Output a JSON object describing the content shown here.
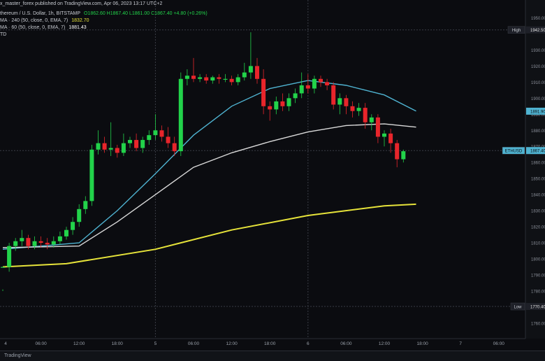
{
  "header": {
    "publisher": "x_master_forex published on TradingView.com, Apr 06, 2023 13:17 UTC+2",
    "symbol": "thereum / U.S. Dollar, 1h, BITSTAMP",
    "ohlc": "O1862.60  H1867.40  L1861.00  C1867.40  +4.80 (+0.26%)",
    "ma240_label": "MA · 240 (50, close, 0, EMA, 7)",
    "ma240_value": "1832.70",
    "ma60_label": "MA · 60 (50, close, 0, EMA, 7)",
    "ma60_value": "1881.43",
    "extra": "TD"
  },
  "footer": {
    "brand": "TradingView"
  },
  "colors": {
    "up": "#22d34a",
    "down": "#e8252b",
    "ema_fast": "#4fb3d1",
    "ema_mid": "#d9d9d9",
    "ema_slow": "#e6e33a",
    "bg": "#0b0c10"
  },
  "chart_data": {
    "type": "candlestick",
    "ylim": [
      1753,
      1955
    ],
    "y_ticks": [
      "1950.00",
      "1942.50",
      "1930.00",
      "1920.00",
      "1910.00",
      "1900.00",
      "1890.00",
      "1880.00",
      "1870.00",
      "1860.00",
      "1850.00",
      "1840.00",
      "1830.00",
      "1820.00",
      "1810.00",
      "1800.00",
      "1790.00",
      "1780.00",
      "1770.00",
      "1760.00"
    ],
    "x_ticks": [
      {
        "label": "4",
        "i": 0
      },
      {
        "label": "06:00",
        "i": 6
      },
      {
        "label": "12:00",
        "i": 12
      },
      {
        "label": "18:00",
        "i": 18
      },
      {
        "label": "5",
        "i": 24
      },
      {
        "label": "06:00",
        "i": 30
      },
      {
        "label": "12:00",
        "i": 36
      },
      {
        "label": "18:00",
        "i": 42
      },
      {
        "label": "6",
        "i": 48
      },
      {
        "label": "06:00",
        "i": 54
      },
      {
        "label": "12:00",
        "i": 60
      },
      {
        "label": "18:00",
        "i": 66
      },
      {
        "label": "7",
        "i": 72
      },
      {
        "label": "06:00",
        "i": 78
      }
    ],
    "day_separators": [
      24,
      48
    ],
    "price_labels": [
      {
        "text": "High",
        "value": "1942.50",
        "price": 1942.5,
        "style": "dark"
      },
      {
        "text": "",
        "value": "1891.90",
        "price": 1891.9,
        "style": "fast"
      },
      {
        "text": "ETHUSD",
        "value": "1867.40",
        "price": 1867.4,
        "style": "fast"
      },
      {
        "text": "Low",
        "value": "1770.40",
        "price": 1770.4,
        "style": "dark"
      }
    ],
    "candles": [
      [
        1795,
        1795,
        1781,
        1780
      ],
      [
        1795,
        1808,
        1810,
        1792
      ],
      [
        1808,
        1811,
        1813,
        1805
      ],
      [
        1811,
        1813,
        1818,
        1808
      ],
      [
        1813,
        1808,
        1815,
        1806
      ],
      [
        1808,
        1811,
        1814,
        1806
      ],
      [
        1811,
        1810,
        1814,
        1807
      ],
      [
        1810,
        1809,
        1813,
        1806
      ],
      [
        1809,
        1811,
        1814,
        1807
      ],
      [
        1811,
        1814,
        1817,
        1809
      ],
      [
        1814,
        1818,
        1820,
        1812
      ],
      [
        1818,
        1823,
        1826,
        1815
      ],
      [
        1823,
        1831,
        1834,
        1820
      ],
      [
        1831,
        1836,
        1839,
        1828
      ],
      [
        1836,
        1868,
        1871,
        1833
      ],
      [
        1868,
        1872,
        1880,
        1865
      ],
      [
        1872,
        1868,
        1876,
        1866
      ],
      [
        1868,
        1869,
        1885,
        1864
      ],
      [
        1869,
        1866,
        1871,
        1863
      ],
      [
        1866,
        1872,
        1878,
        1864
      ],
      [
        1872,
        1874,
        1876,
        1869
      ],
      [
        1874,
        1869,
        1878,
        1867
      ],
      [
        1869,
        1874,
        1876,
        1866
      ],
      [
        1874,
        1877,
        1880,
        1871
      ],
      [
        1877,
        1880,
        1890,
        1874
      ],
      [
        1880,
        1876,
        1883,
        1873
      ],
      [
        1876,
        1872,
        1882,
        1869
      ],
      [
        1872,
        1867,
        1876,
        1864
      ],
      [
        1867,
        1912,
        1916,
        1864
      ],
      [
        1912,
        1914,
        1918,
        1908
      ],
      [
        1914,
        1912,
        1925,
        1910
      ],
      [
        1912,
        1913,
        1915,
        1910
      ],
      [
        1913,
        1911,
        1915,
        1909
      ],
      [
        1911,
        1913,
        1914,
        1909
      ],
      [
        1913,
        1912,
        1915,
        1909
      ],
      [
        1912,
        1912,
        1915,
        1910
      ],
      [
        1912,
        1910,
        1914,
        1908
      ],
      [
        1910,
        1913,
        1915,
        1908
      ],
      [
        1913,
        1916,
        1922,
        1911
      ],
      [
        1916,
        1920,
        1941,
        1912
      ],
      [
        1920,
        1912,
        1925,
        1909
      ],
      [
        1912,
        1895,
        1918,
        1890
      ],
      [
        1895,
        1893,
        1898,
        1886
      ],
      [
        1893,
        1898,
        1901,
        1890
      ],
      [
        1898,
        1895,
        1903,
        1892
      ],
      [
        1895,
        1900,
        1903,
        1892
      ],
      [
        1900,
        1903,
        1906,
        1897
      ],
      [
        1903,
        1908,
        1916,
        1900
      ],
      [
        1908,
        1906,
        1915,
        1903
      ],
      [
        1906,
        1912,
        1914,
        1903
      ],
      [
        1912,
        1910,
        1914,
        1907
      ],
      [
        1910,
        1908,
        1912,
        1905
      ],
      [
        1908,
        1896,
        1910,
        1893
      ],
      [
        1896,
        1900,
        1903,
        1890
      ],
      [
        1900,
        1895,
        1902,
        1890
      ],
      [
        1895,
        1892,
        1898,
        1888
      ],
      [
        1892,
        1894,
        1897,
        1889
      ],
      [
        1894,
        1885,
        1897,
        1881
      ],
      [
        1885,
        1888,
        1890,
        1880
      ],
      [
        1888,
        1876,
        1890,
        1872
      ],
      [
        1876,
        1878,
        1880,
        1870
      ],
      [
        1878,
        1872,
        1881,
        1866
      ],
      [
        1872,
        1862,
        1874,
        1857
      ],
      [
        1862,
        1867,
        1868,
        1860
      ]
    ],
    "series": [
      {
        "color": "#4fb3d1",
        "points": [
          [
            0,
            1806
          ],
          [
            12,
            1810
          ],
          [
            18,
            1830
          ],
          [
            24,
            1853
          ],
          [
            30,
            1877
          ],
          [
            36,
            1895
          ],
          [
            42,
            1906
          ],
          [
            48,
            1911
          ],
          [
            54,
            1908
          ],
          [
            60,
            1902
          ],
          [
            65,
            1892
          ]
        ]
      },
      {
        "color": "#d9d9d9",
        "points": [
          [
            0,
            1807
          ],
          [
            12,
            1808
          ],
          [
            18,
            1823
          ],
          [
            24,
            1840
          ],
          [
            30,
            1857
          ],
          [
            36,
            1866
          ],
          [
            42,
            1873
          ],
          [
            48,
            1879
          ],
          [
            54,
            1883
          ],
          [
            60,
            1884
          ],
          [
            65,
            1882
          ]
        ]
      },
      {
        "color": "#e6e33a",
        "points": [
          [
            0,
            1795
          ],
          [
            10,
            1797
          ],
          [
            24,
            1806
          ],
          [
            36,
            1818
          ],
          [
            48,
            1827
          ],
          [
            60,
            1833
          ],
          [
            65,
            1834
          ]
        ]
      }
    ]
  }
}
